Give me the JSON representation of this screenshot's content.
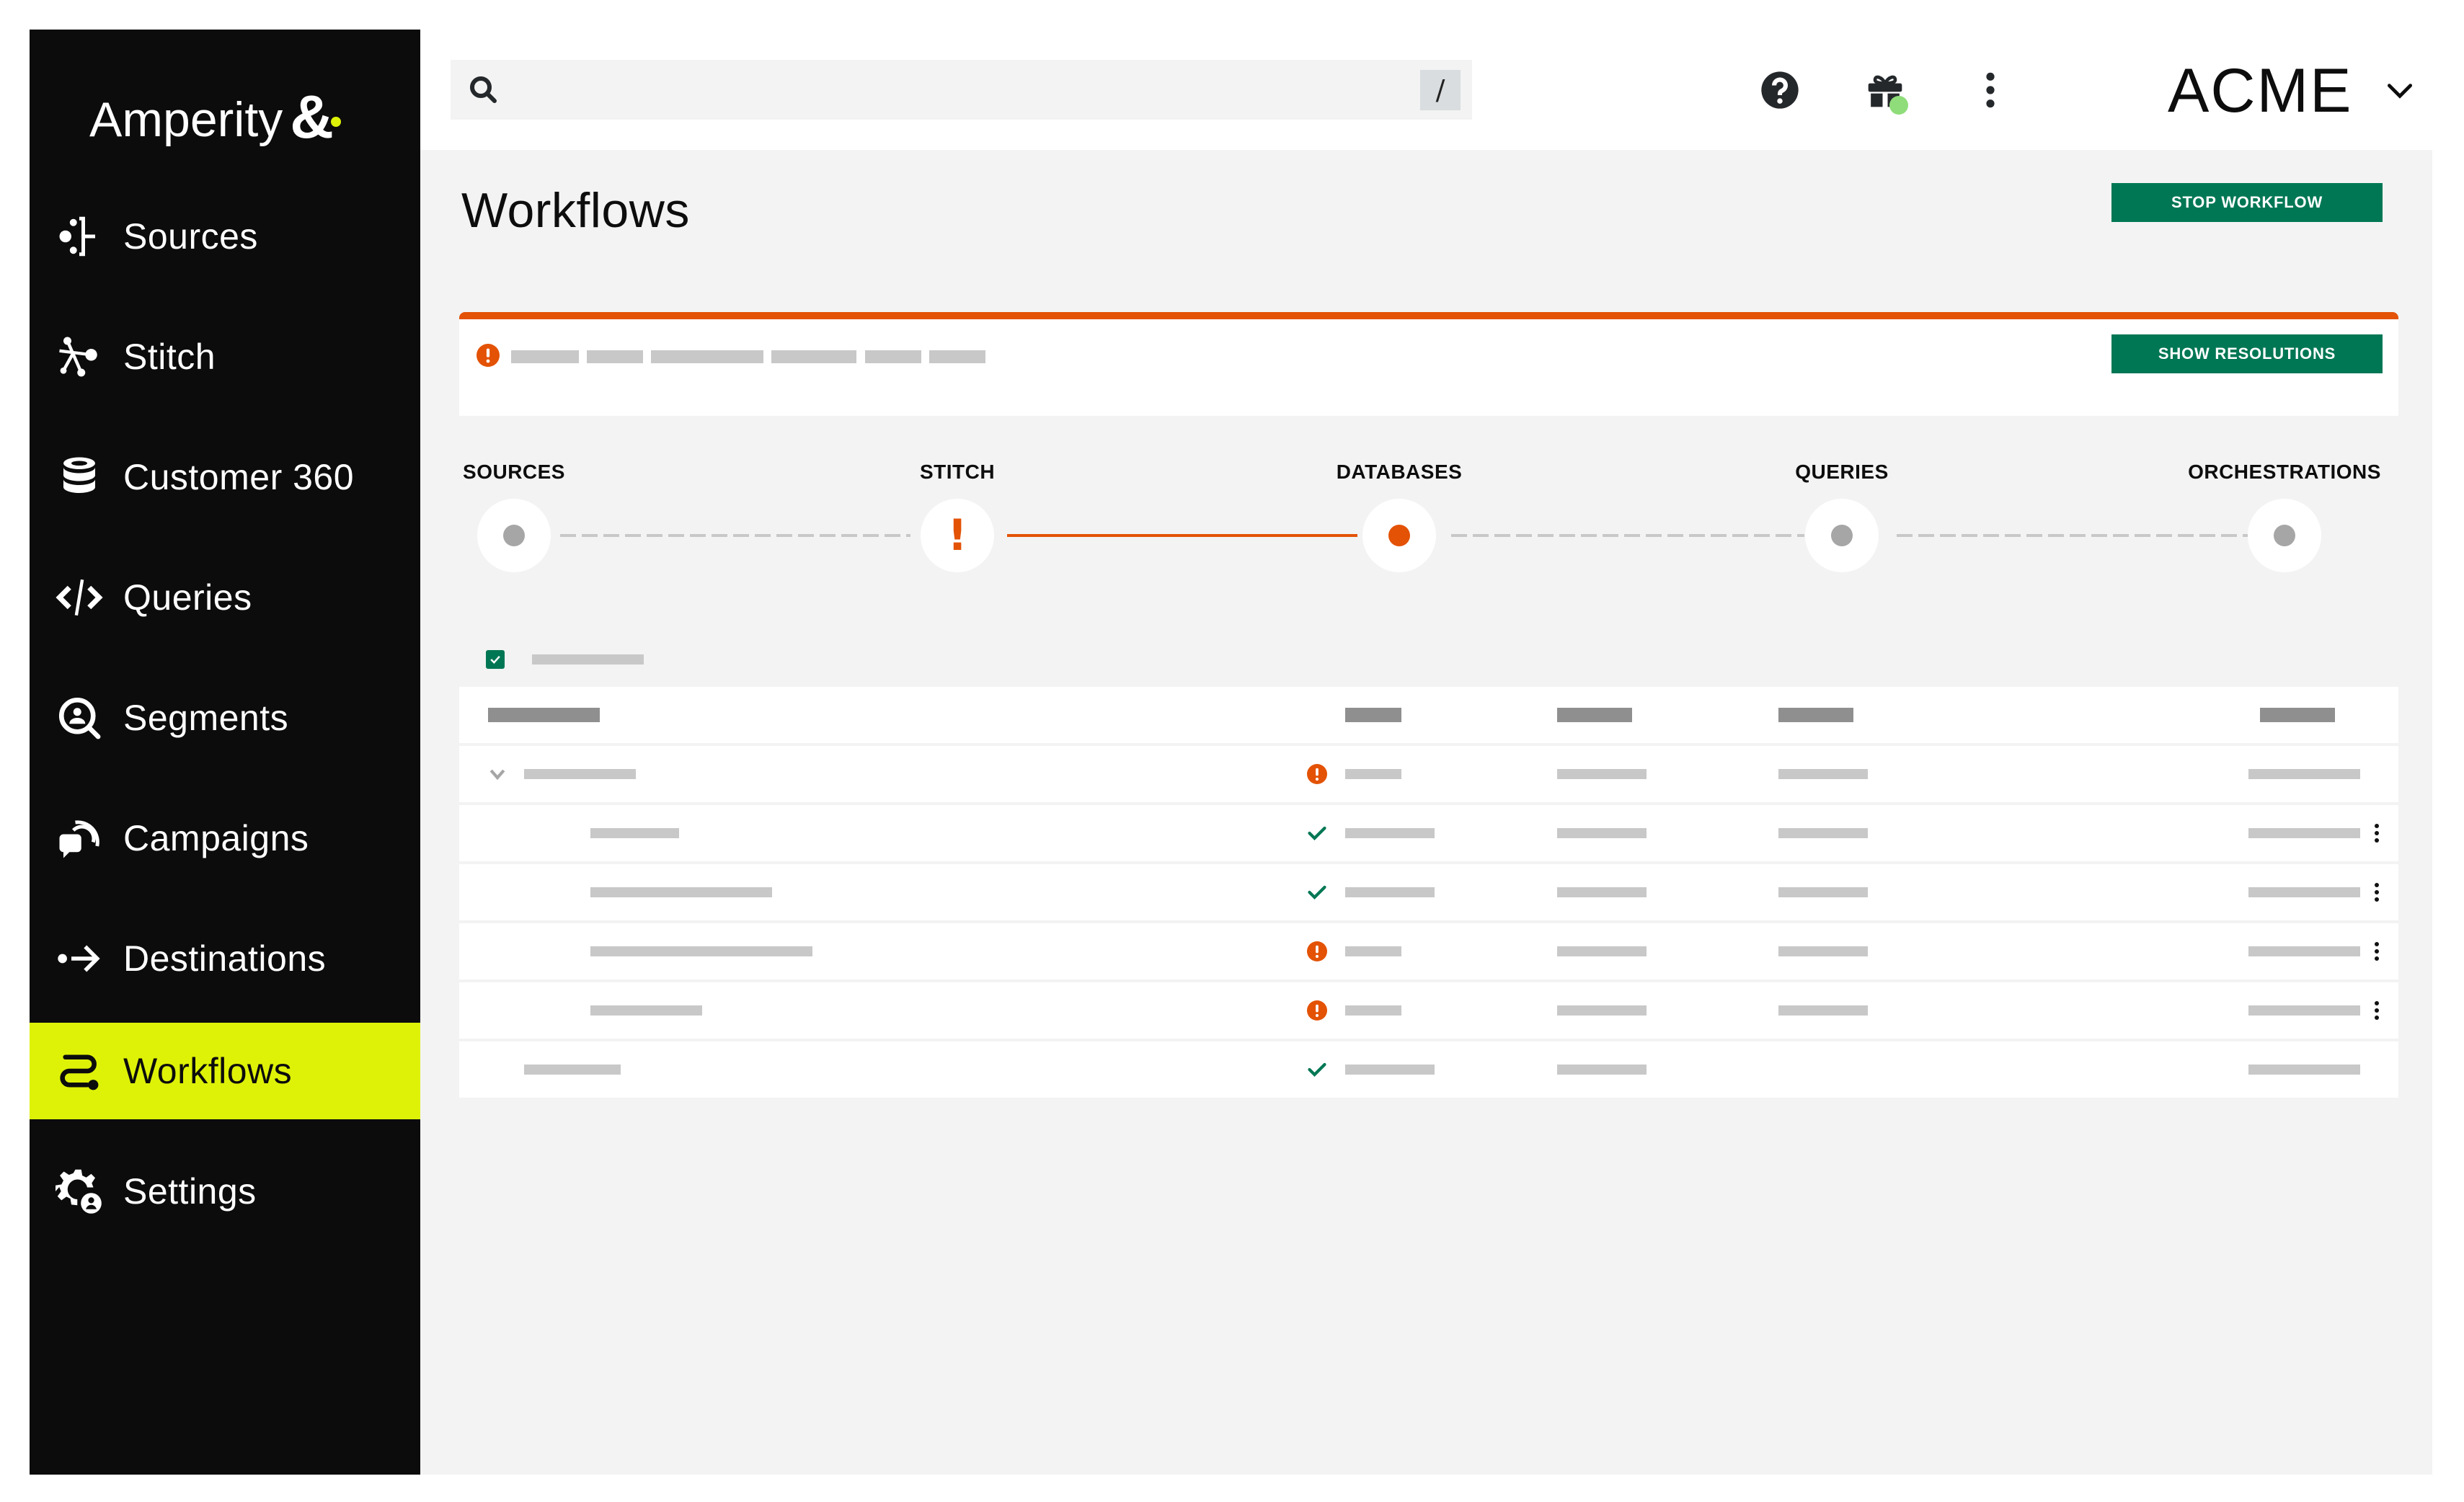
{
  "app": {
    "brand": "Amperity",
    "brand_mark": "&",
    "accent_color": "#def207",
    "primary_color": "#007754",
    "error_color": "#e35205",
    "success_color": "#007754"
  },
  "sidebar": {
    "items": [
      {
        "label": "Sources",
        "icon": "sources-icon",
        "active": false
      },
      {
        "label": "Stitch",
        "icon": "stitch-icon",
        "active": false
      },
      {
        "label": "Customer 360",
        "icon": "database-icon",
        "active": false
      },
      {
        "label": "Queries",
        "icon": "code-icon",
        "active": false
      },
      {
        "label": "Segments",
        "icon": "segment-search-icon",
        "active": false
      },
      {
        "label": "Campaigns",
        "icon": "campaign-icon",
        "active": false
      },
      {
        "label": "Destinations",
        "icon": "destination-arrow-icon",
        "active": false
      },
      {
        "label": "Workflows",
        "icon": "workflow-icon",
        "active": true
      },
      {
        "label": "Settings",
        "icon": "settings-user-icon",
        "active": false
      }
    ]
  },
  "header": {
    "search": {
      "placeholder": "",
      "value": "",
      "shortcut": "/"
    },
    "icons": [
      "help-icon",
      "gift-icon",
      "more-vertical-icon"
    ],
    "gift_notification": true,
    "account": {
      "name": "ACME"
    }
  },
  "main": {
    "title": "Workflows",
    "stop_button": "STOP WORKFLOW",
    "alert": {
      "status": "error",
      "message_redacted": true,
      "action_button": "SHOW RESOLUTIONS"
    },
    "stepper": {
      "steps": [
        {
          "label": "SOURCES",
          "status": "pending"
        },
        {
          "label": "STITCH",
          "status": "error"
        },
        {
          "label": "DATABASES",
          "status": "running"
        },
        {
          "label": "QUERIES",
          "status": "pending"
        },
        {
          "label": "ORCHESTRATIONS",
          "status": "pending"
        }
      ],
      "connectors": [
        "pending",
        "error",
        "pending",
        "pending"
      ]
    },
    "table": {
      "select_all_checked": true,
      "content_redacted": true,
      "rows": [
        {
          "type": "group",
          "expanded": true,
          "status": "error",
          "has_menu": false
        },
        {
          "type": "child",
          "status": "success",
          "has_menu": true
        },
        {
          "type": "child",
          "status": "success",
          "has_menu": true
        },
        {
          "type": "child",
          "status": "error",
          "has_menu": true
        },
        {
          "type": "child",
          "status": "error",
          "has_menu": true
        },
        {
          "type": "item",
          "status": "success",
          "has_menu": false
        }
      ]
    }
  }
}
